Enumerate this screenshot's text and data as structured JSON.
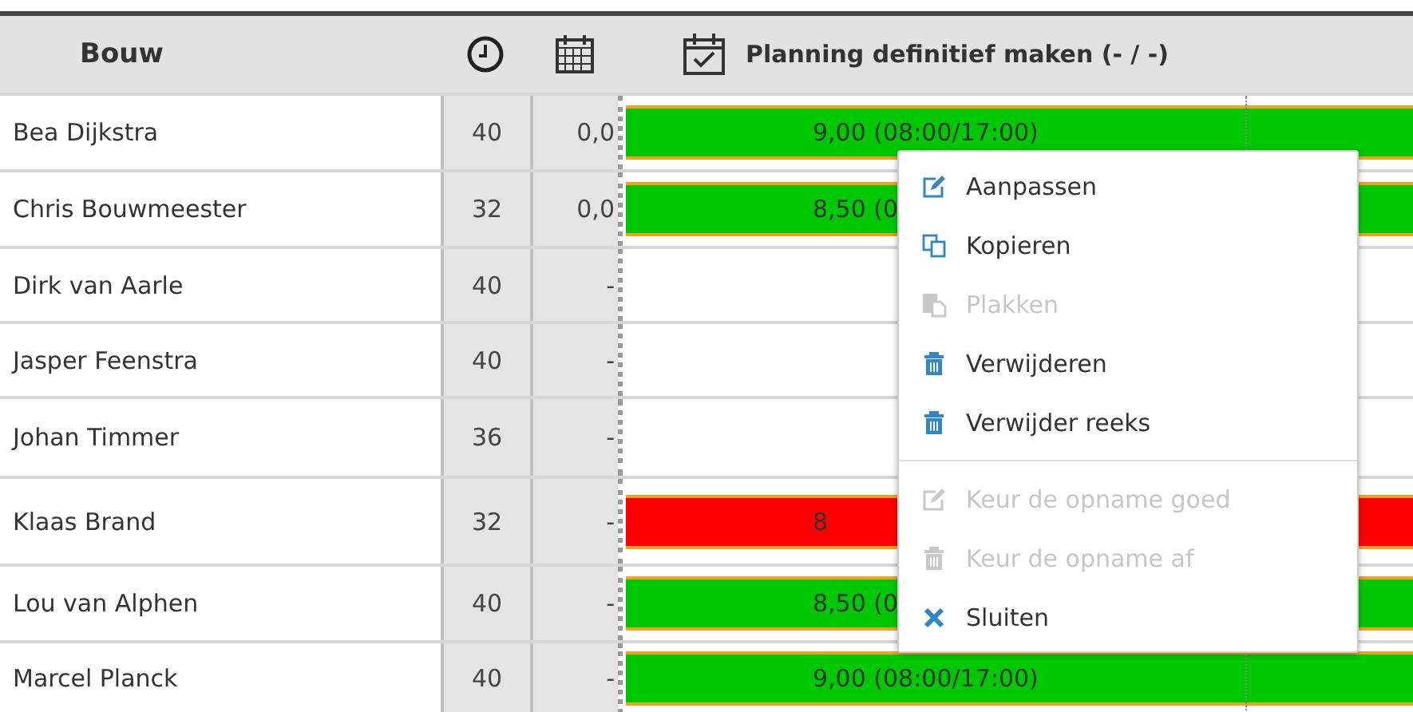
{
  "header": {
    "title": "Bouw",
    "planning_title": "Planning definitief maken (- / -)"
  },
  "rows": [
    {
      "name": "Bea Dijkstra",
      "hours": "40",
      "column_3": "0,0",
      "bar": {
        "color": "#00c800",
        "text": "9,00 (08:00/17:00)"
      }
    },
    {
      "name": "Chris Bouwmeester",
      "hours": "32",
      "column_3": "0,0",
      "bar": {
        "color": "#00c800",
        "text": "8,50 (0"
      }
    },
    {
      "name": "Dirk van Aarle",
      "hours": "40",
      "column_3": "-"
    },
    {
      "name": "Jasper Feenstra",
      "hours": "40",
      "column_3": "-"
    },
    {
      "name": "Johan Timmer",
      "hours": "36",
      "column_3": "-"
    },
    {
      "name": "Klaas Brand",
      "hours": "32",
      "column_3": "-",
      "bar": {
        "color": "#ff0000",
        "text": "8"
      }
    },
    {
      "name": "Lou van Alphen",
      "hours": "40",
      "column_3": "-",
      "bar": {
        "color": "#00c800",
        "text": "8,50 (0"
      }
    },
    {
      "name": "Marcel Planck",
      "hours": "40",
      "column_3": "-",
      "bar": {
        "color": "#00c800",
        "text": "9,00 (08:00/17:00)"
      }
    }
  ],
  "context_menu": {
    "groups": [
      [
        {
          "label": "Aanpassen",
          "kind": "edit",
          "disabled": false
        },
        {
          "label": "Kopieren",
          "kind": "copy",
          "disabled": false
        },
        {
          "label": "Plakken",
          "kind": "paste",
          "disabled": true
        },
        {
          "label": "Verwijderen",
          "kind": "trash",
          "disabled": false
        },
        {
          "label": "Verwijder reeks",
          "kind": "trash",
          "disabled": false
        }
      ],
      [
        {
          "label": "Keur de opname goed",
          "kind": "edit",
          "disabled": true
        },
        {
          "label": "Keur de opname af",
          "kind": "trash",
          "disabled": true
        },
        {
          "label": "Sluiten",
          "kind": "close",
          "disabled": false
        }
      ]
    ]
  }
}
